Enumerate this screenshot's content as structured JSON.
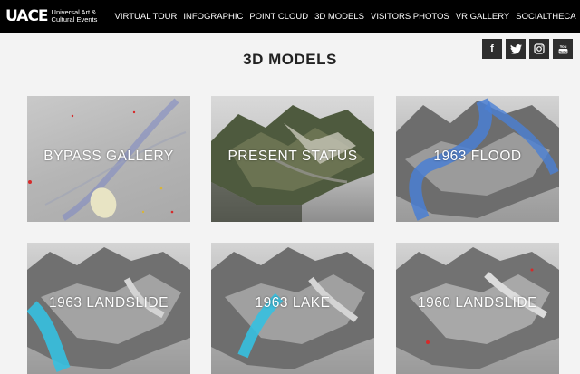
{
  "header": {
    "logo_mark": "UACE",
    "logo_text": "Universal Art & Cultural Events",
    "nav": [
      {
        "label": "VIRTUAL TOUR"
      },
      {
        "label": "INFOGRAPHIC"
      },
      {
        "label": "POINT CLOUD"
      },
      {
        "label": "3D MODELS"
      },
      {
        "label": "VISITORS PHOTOS"
      },
      {
        "label": "VR GALLERY"
      },
      {
        "label": "SOCIALTHECA"
      }
    ]
  },
  "social": {
    "facebook": "f",
    "twitter": "t",
    "instagram": "◎",
    "youtube": "▶"
  },
  "page_title": "3D MODELS",
  "tiles": [
    {
      "label": "BYPASS GALLERY"
    },
    {
      "label": "PRESENT STATUS"
    },
    {
      "label": "1963 FLOOD"
    },
    {
      "label": "1963 LANDSLIDE"
    },
    {
      "label": "1963 LAKE"
    },
    {
      "label": "1960 LANDSLIDE"
    }
  ],
  "colors": {
    "header_bg": "#000000",
    "page_bg": "#f3f3f3",
    "water": "#3aa0d8",
    "flood": "#4a7fd4"
  }
}
